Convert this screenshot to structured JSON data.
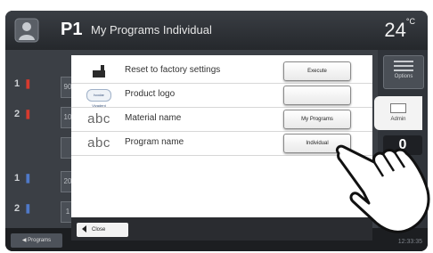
{
  "header": {
    "user_icon": "user-profile-icon",
    "program_number": "P1",
    "program_title": "My Programs Individual",
    "temperature": "24",
    "temperature_unit": "°C"
  },
  "background": {
    "rows": [
      {
        "index": "1",
        "marker_color": "#d73a2e",
        "cell": "90"
      },
      {
        "index": "2",
        "marker_color": "#d73a2e",
        "cell": "10"
      },
      {
        "index": "1",
        "marker_color": "#4f79c9",
        "cell": "20"
      },
      {
        "index": "2",
        "marker_color": "#4f79c9",
        "cell": "1"
      }
    ]
  },
  "right_panel": {
    "options_label": "Options",
    "admin_label": "Admin",
    "counter": "0"
  },
  "dialog": {
    "rows": [
      {
        "icon": "factory-icon",
        "label": "Reset to factory settings",
        "button": "Execute"
      },
      {
        "icon": "product-logo-icon",
        "logo_text": "Ivoclar Vivadent",
        "label": "Product logo",
        "button": ""
      },
      {
        "icon": "abc-text-icon",
        "icon_text": "abc",
        "label": "Material name",
        "button": "My Programs"
      },
      {
        "icon": "abc-text-icon",
        "icon_text": "abc",
        "label": "Program name",
        "button": "Individual"
      }
    ],
    "close_label": "Close"
  },
  "bottom": {
    "programs_label": "Programs",
    "clock": "12:33:35"
  }
}
